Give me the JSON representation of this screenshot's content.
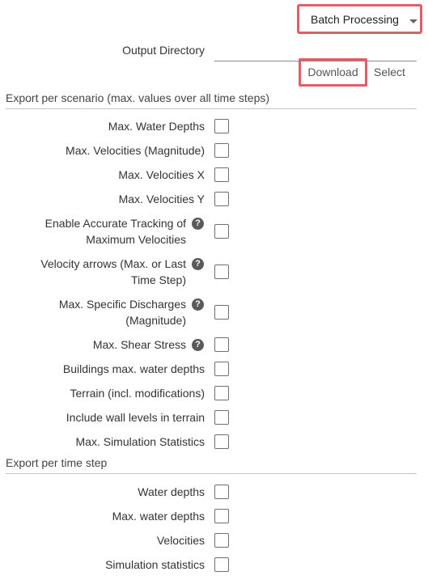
{
  "header": {
    "mode_select": "Batch Processing"
  },
  "output": {
    "label": "Output Directory",
    "value": "",
    "download_label": "Download",
    "select_label": "Select"
  },
  "sections": {
    "per_scenario": {
      "title": "Export per scenario (max. values over all time steps)",
      "items": [
        {
          "label": "Max. Water Depths",
          "help": false,
          "checked": false
        },
        {
          "label": "Max. Velocities (Magnitude)",
          "help": false,
          "checked": false
        },
        {
          "label": "Max. Velocities X",
          "help": false,
          "checked": false
        },
        {
          "label": "Max. Velocities Y",
          "help": false,
          "checked": false
        },
        {
          "label": "Enable Accurate Tracking of",
          "label2": "Maximum Velocities",
          "help": true,
          "checked": false
        },
        {
          "label": "Velocity arrows (Max. or Last",
          "label2": "Time Step)",
          "help": true,
          "checked": false
        },
        {
          "label": "Max. Specific Discharges",
          "label2": "(Magnitude)",
          "help": true,
          "checked": false
        },
        {
          "label": "Max. Shear Stress",
          "help": true,
          "checked": false
        },
        {
          "label": "Buildings max. water depths",
          "help": false,
          "checked": false
        },
        {
          "label": "Terrain (incl. modifications)",
          "help": false,
          "checked": false
        },
        {
          "label": "Include wall levels in terrain",
          "help": false,
          "checked": false
        },
        {
          "label": "Max. Simulation Statistics",
          "help": false,
          "checked": false
        }
      ]
    },
    "per_time_step": {
      "title": "Export per time step",
      "items": [
        {
          "label": "Water depths",
          "help": false,
          "checked": false
        },
        {
          "label": "Max. water depths",
          "help": false,
          "checked": false
        },
        {
          "label": "Velocities",
          "help": false,
          "checked": false
        },
        {
          "label": "Simulation statistics",
          "help": false,
          "checked": false
        }
      ]
    }
  }
}
